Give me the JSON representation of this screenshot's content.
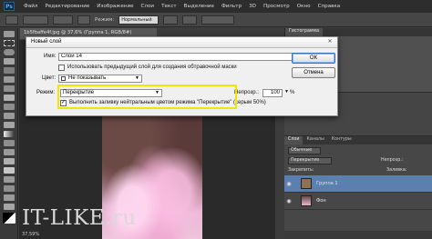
{
  "menubar": {
    "logo": "Ps",
    "items": [
      "Файл",
      "Редактирование",
      "Изображение",
      "Слои",
      "Текст",
      "Выделение",
      "Фильтр",
      "3D",
      "Просмотр",
      "Окно",
      "Справка"
    ]
  },
  "options": {
    "mode_label": "Режим:",
    "mode_value": "Нормальный"
  },
  "document": {
    "tab_title": "1b5fbaffe4f.jpg @ 37,6% (Группа 1, RGB/8#)",
    "status": "37,59%"
  },
  "watermark": "IT-LIKE.ru",
  "dialog": {
    "title": "Новый слой",
    "name_label": "Имя:",
    "name_value": "Слой 14",
    "clip_checkbox_label": "Использовать предыдущий слой для создания обтравочной маски",
    "color_label": "Цвет:",
    "color_value": "Не показывать",
    "mode_label": "Режим:",
    "mode_value": "Перекрытие",
    "opacity_label": "Непрозр.:",
    "opacity_value": "100",
    "opacity_unit": "%",
    "fill_checkbox_label": "Выполнить заливку нейтральным цветом режима \"Перекрытие\" (серым 50%)",
    "ok_label": "ОК",
    "cancel_label": "Отмена"
  },
  "panels": {
    "top_tab": "Гистограмма",
    "layers_tabs": [
      "Слои",
      "Каналы",
      "Контуры"
    ],
    "kind_label": "Обычные",
    "blend_value": "Перекрытие",
    "opacity_label": "Непрозр.:",
    "lock_label": "Закрепить:",
    "fill_label": "Заливка:",
    "layers": [
      "Группа 1",
      "Фон"
    ]
  },
  "colors": {
    "highlight": "#f2e600",
    "dialog_bg": "#f0f0f0",
    "ui_dark": "#3c3c3c"
  }
}
